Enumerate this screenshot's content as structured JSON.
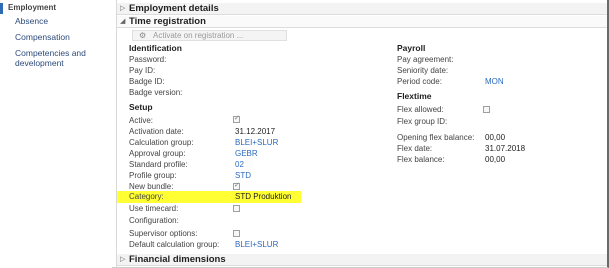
{
  "nav": {
    "items": [
      {
        "label": "Employment",
        "active": true
      },
      {
        "label": "Absence"
      },
      {
        "label": "Compensation"
      },
      {
        "label": "Competencies and"
      },
      {
        "label": "development"
      }
    ]
  },
  "tabs": {
    "employment_details": "Employment details",
    "time_registration": "Time registration",
    "financial_dimensions": "Financial dimensions"
  },
  "toolbar": {
    "activate_label": "Activate on registration ...",
    "activate_icon": "user-clock-icon"
  },
  "identification": {
    "title": "Identification",
    "password": "Password:",
    "pay_id": "Pay ID:",
    "badge_id": "Badge ID:",
    "badge_version": "Badge version:"
  },
  "setup": {
    "title": "Setup",
    "active": {
      "label": "Active:",
      "checked": true
    },
    "activation_date": {
      "label": "Activation date:",
      "value": "31.12.2017"
    },
    "calculation_group": {
      "label": "Calculation group:",
      "value": "BLEI+SLUR"
    },
    "approval_group": {
      "label": "Approval group:",
      "value": "GEBR"
    },
    "standard_profile": {
      "label": "Standard profile:",
      "value": "02"
    },
    "profile_group": {
      "label": "Profile group:",
      "value": "STD"
    },
    "new_bundle": {
      "label": "New bundle:",
      "checked": true
    },
    "category": {
      "label": "Category:",
      "value": "STD Produktion"
    },
    "use_timecard": {
      "label": "Use timecard:",
      "checked": false
    },
    "configuration": {
      "label": "Configuration:"
    },
    "supervisor_options": {
      "label": "Supervisor options:",
      "checked": false
    },
    "default_calculation_group": {
      "label": "Default calculation group:",
      "value": "BLEI+SLUR"
    }
  },
  "payroll": {
    "title": "Payroll",
    "pay_agreement": "Pay agreement:",
    "seniority_date": "Seniority date:",
    "period_code": {
      "label": "Period code:",
      "value": "MON"
    }
  },
  "flextime": {
    "title": "Flextime",
    "flex_allowed": {
      "label": "Flex allowed:",
      "checked": false
    },
    "flex_group_id": "Flex group ID:",
    "opening_flex_balance": {
      "label": "Opening flex balance:",
      "value": "00,00"
    },
    "flex_date": {
      "label": "Flex date:",
      "value": "31.07.2018"
    },
    "flex_balance": {
      "label": "Flex balance:",
      "value": "00,00"
    }
  },
  "colors": {
    "highlight": "#ffff33",
    "link": "#2a6ac0",
    "active_bar": "#2d6bb5"
  }
}
